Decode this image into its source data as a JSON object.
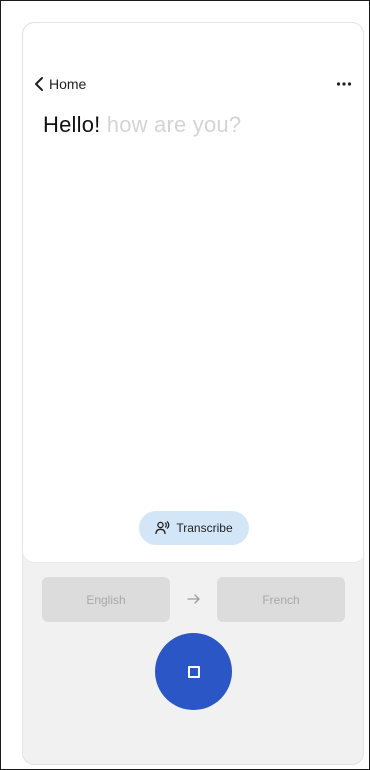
{
  "nav": {
    "back_label": "Home"
  },
  "transcript": {
    "final_text": "Hello!",
    "interim_text": "how are you?"
  },
  "transcribe_button": {
    "label": "Transcribe"
  },
  "languages": {
    "source": "English",
    "target": "French"
  },
  "icons": {
    "back": "chevron-left-icon",
    "more": "more-horizontal-icon",
    "transcribe": "person-voice-icon",
    "swap": "arrow-right-icon",
    "stop": "stop-icon"
  },
  "colors": {
    "accent": "#2a56c6",
    "chip": "#d3e6f8",
    "interim_text": "#d4d4d4"
  }
}
